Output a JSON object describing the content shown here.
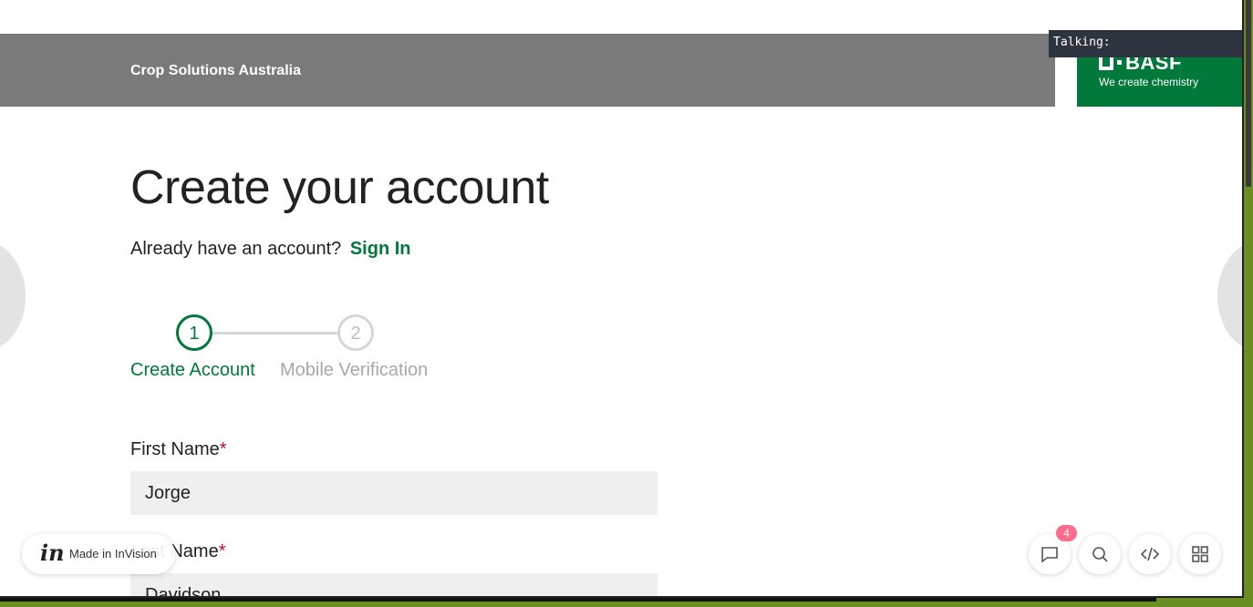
{
  "header": {
    "title": "Crop Solutions Australia",
    "logo_text": "BASF",
    "logo_tagline": "We create chemistry"
  },
  "overlay": {
    "talking_label": "Talking:"
  },
  "main": {
    "title": "Create your account",
    "signin_prompt": "Already have an account?",
    "signin_link": "Sign In"
  },
  "stepper": {
    "steps": [
      {
        "number": "1",
        "label": "Create Account",
        "active": true
      },
      {
        "number": "2",
        "label": "Mobile Verification",
        "active": false
      }
    ]
  },
  "form": {
    "first_name": {
      "label": "First Name",
      "required_mark": "*",
      "value": "Jorge"
    },
    "last_name": {
      "label": "Last Name",
      "required_mark": "*",
      "value": "Davidson"
    }
  },
  "invision": {
    "logo": "in",
    "label": "Made in InVision"
  },
  "tools": {
    "comment_count": "4",
    "icons": [
      "comment-icon",
      "search-icon",
      "code-icon",
      "grid-icon"
    ]
  },
  "colors": {
    "brand_green": "#00793a",
    "header_gray": "#7a7a7a",
    "required_red": "#c0112e",
    "badge_pink": "#ff6b8b"
  }
}
